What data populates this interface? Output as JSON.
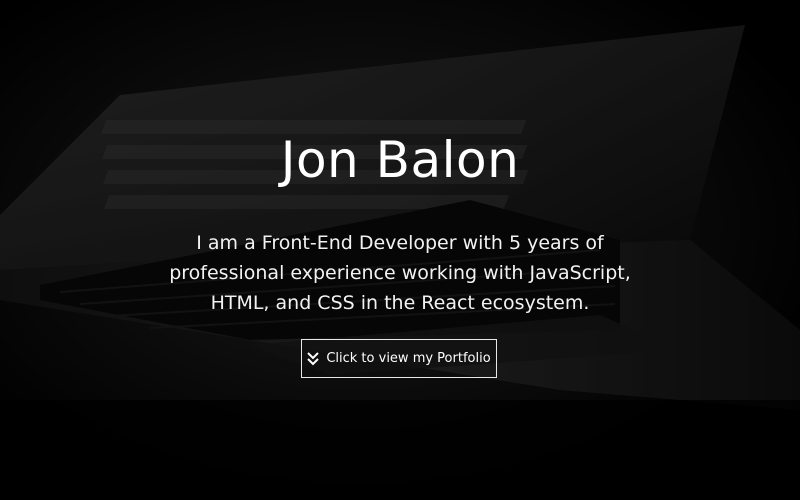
{
  "hero": {
    "name": "Jon Balon",
    "tagline": "I am a Front-End Developer with 5 years of professional experience working with JavaScript, HTML, and CSS in the React ecosystem.",
    "cta_label": "Click to view my Portfolio",
    "cta_icon": "double-chevron-down-icon",
    "background_image": "laptop-keyboard-photo"
  },
  "colors": {
    "background": "#000000",
    "text": "#ffffff",
    "button_border": "#e8e8e8"
  }
}
